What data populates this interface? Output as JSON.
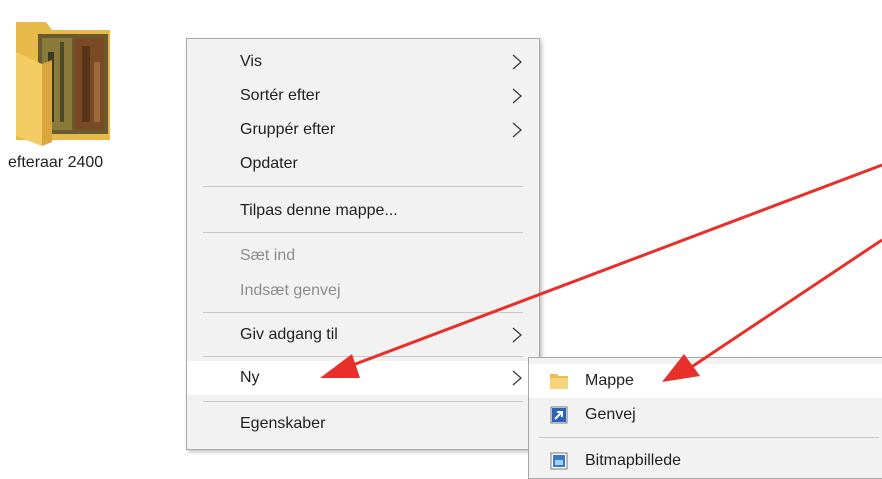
{
  "desktop": {
    "folder": {
      "label": "efteraar 2400"
    }
  },
  "context_menu": {
    "items": [
      {
        "label": "Vis",
        "submenu": true,
        "disabled": false
      },
      {
        "label": "Sortér efter",
        "submenu": true,
        "disabled": false
      },
      {
        "label": "Gruppér efter",
        "submenu": true,
        "disabled": false
      },
      {
        "label": "Opdater",
        "submenu": false,
        "disabled": false
      },
      {
        "label": "Tilpas denne mappe...",
        "submenu": false,
        "disabled": false
      },
      {
        "label": "Sæt ind",
        "submenu": false,
        "disabled": true
      },
      {
        "label": "Indsæt genvej",
        "submenu": false,
        "disabled": true
      },
      {
        "label": "Giv adgang til",
        "submenu": true,
        "disabled": false
      },
      {
        "label": "Ny",
        "submenu": true,
        "disabled": false,
        "highlighted": true
      },
      {
        "label": "Egenskaber",
        "submenu": false,
        "disabled": false
      }
    ]
  },
  "new_submenu": {
    "items": [
      {
        "label": "Mappe",
        "icon": "folder-icon",
        "highlighted": true
      },
      {
        "label": "Genvej",
        "icon": "shortcut-icon"
      },
      {
        "label": "Bitmapbillede",
        "icon": "bitmap-icon"
      }
    ]
  },
  "annotation": {
    "arrow_color": "#e8302b"
  }
}
